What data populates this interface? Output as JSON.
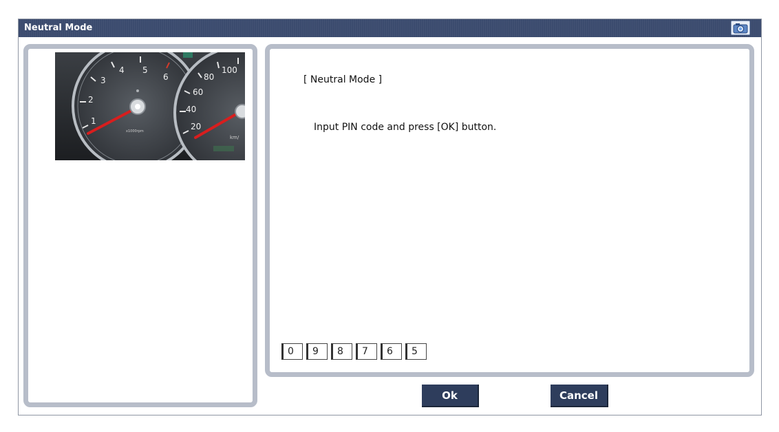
{
  "window": {
    "title": "Neutral Mode"
  },
  "toolbar": {
    "camera_icon": "camera-icon"
  },
  "gauge_image": {
    "tach_numbers": [
      "1",
      "2",
      "3",
      "4",
      "5",
      "6"
    ],
    "speed_numbers": [
      "20",
      "40",
      "60",
      "80",
      "100"
    ],
    "tach_unit": "x1000rpm",
    "speed_unit": "km/"
  },
  "message": {
    "title": "[ Neutral Mode ]",
    "instruction": "Input PIN code and press [OK] button."
  },
  "pin": {
    "digits": [
      "0",
      "9",
      "8",
      "7",
      "6",
      "5"
    ]
  },
  "buttons": {
    "ok": "Ok",
    "cancel": "Cancel"
  },
  "colors": {
    "titlebar": "#3b4b6e",
    "panel_border": "#b7bdc9",
    "button": "#2e3d5c"
  }
}
